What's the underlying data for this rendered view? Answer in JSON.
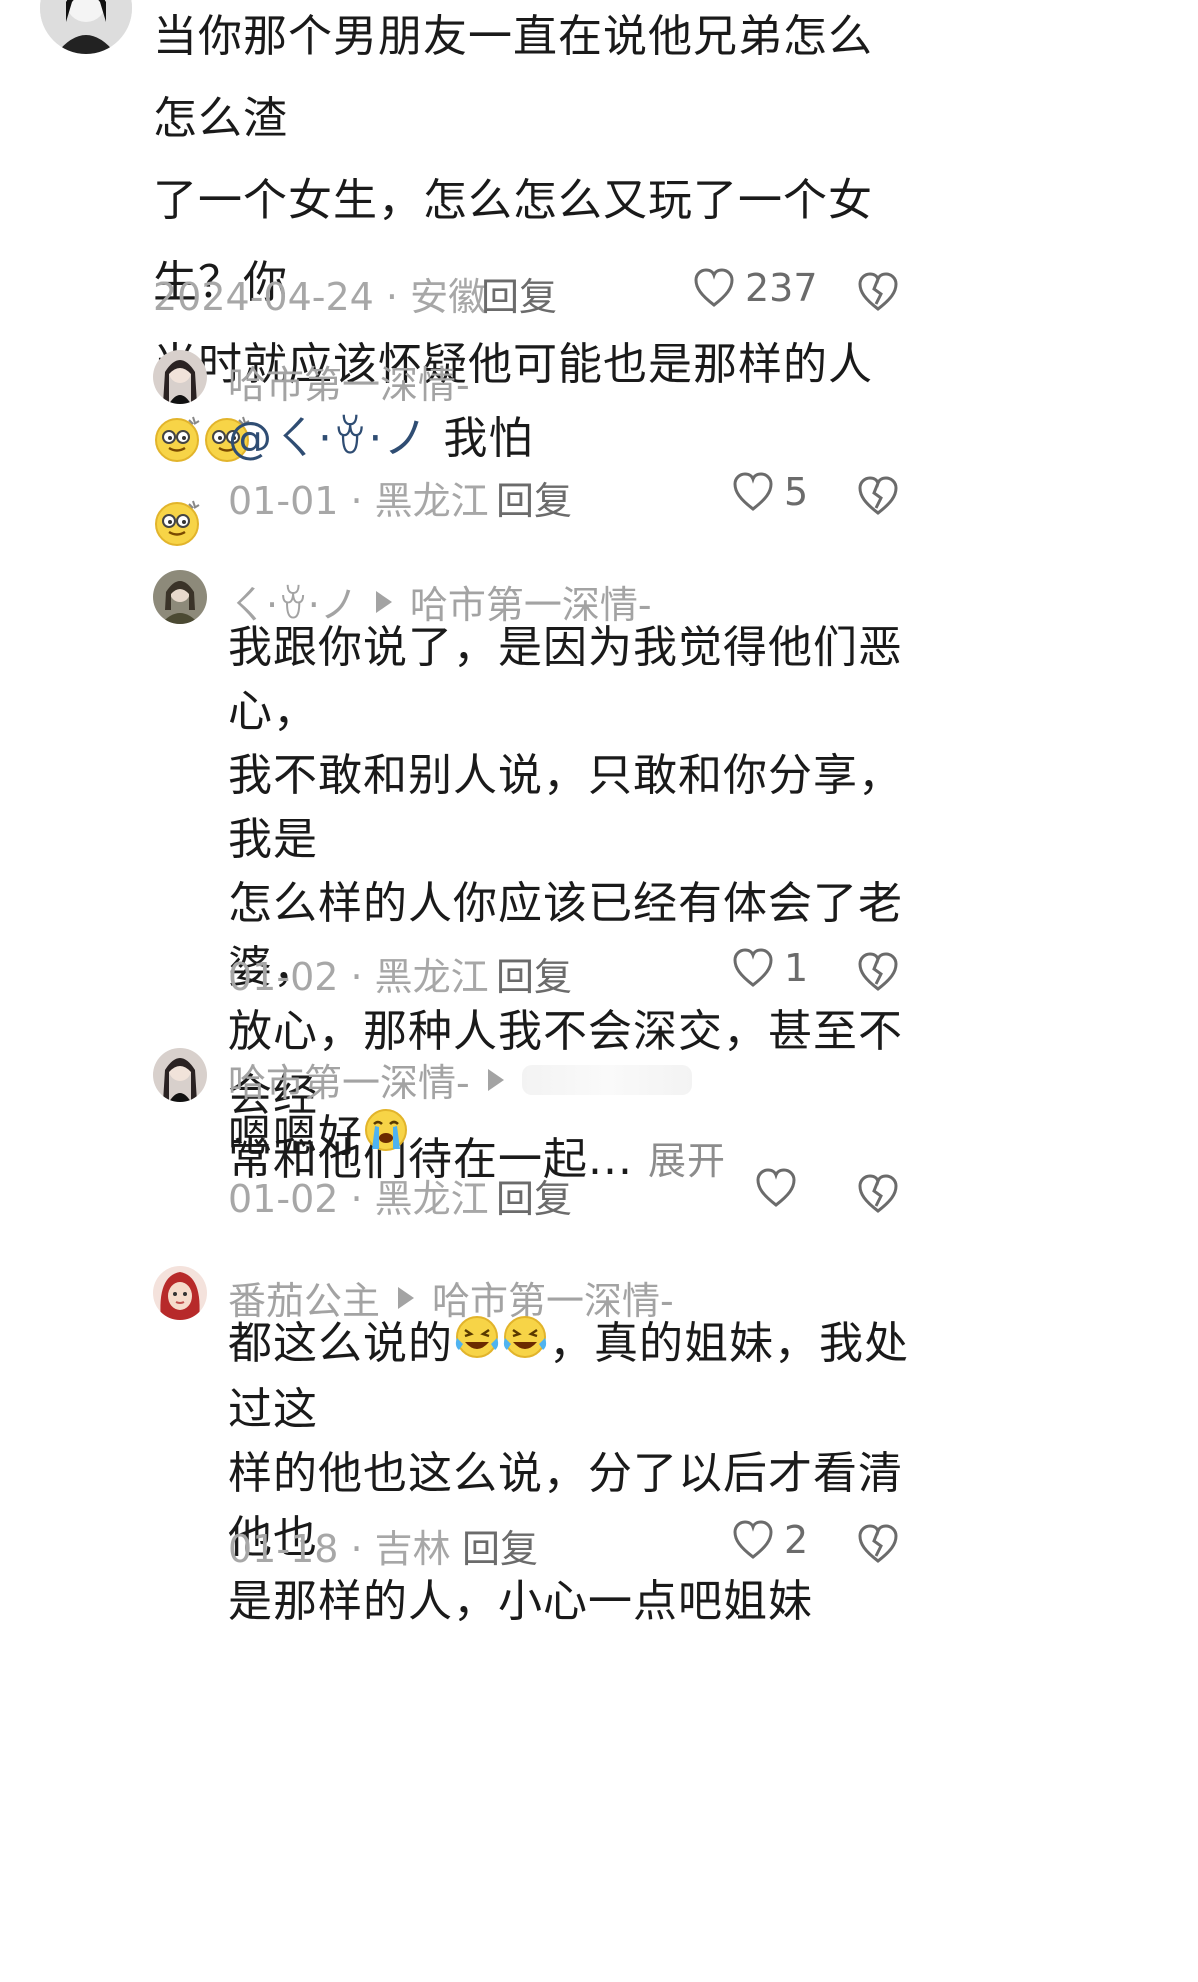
{
  "comments": [
    {
      "text": "当你那个男朋友一直在说他兄弟怎么怎么渣了一个女生，怎么怎么又玩了一个女生？你当时就应该怀疑他可能也是那样的人",
      "date": "2024-04-24 · 安徽",
      "reply": "回复",
      "likes": "237"
    },
    {
      "name": "哈市第一深情-",
      "mention": "@ㄑ·ꈊ·ノ",
      "text": "我怕",
      "date": "01-01 · 黑龙江",
      "reply": "回复",
      "likes": "5"
    },
    {
      "name": "ㄑ·ꈊ·ノ",
      "target": "哈市第一深情-",
      "text": "我跟你说了，是因为我觉得他们恶心，我不敢和别人说，只敢和你分享，我是怎么样的人你应该已经有体会了老婆，放心，那种人我不会深交，甚至不会经常和他们待在一起...",
      "expand": "展开",
      "date": "01-02 · 黑龙江",
      "reply": "回复",
      "likes": "1"
    },
    {
      "name": "哈市第一深情-",
      "text": "嗯嗯好",
      "date": "01-02 · 黑龙江",
      "reply": "回复",
      "likes": ""
    },
    {
      "name": "番茄公主",
      "target": "哈市第一深情-",
      "text_a": "都这么说的",
      "text_b": "，真的姐妹，我处过这样的他也这么说，分了以后才看清他也是那样的人，小心一点吧姐妹",
      "date": "01-18 · 吉林",
      "reply": "回复",
      "likes": "2"
    }
  ],
  "lines": {
    "c0": [
      "当你那个男朋友一直在说他兄弟怎么怎么渣",
      "了一个女生，怎么怎么又玩了一个女生？你",
      "当时就应该怀疑他可能也是那样的人"
    ],
    "c2": [
      "我跟你说了，是因为我觉得他们恶心，",
      "我不敢和别人说，只敢和你分享，我是",
      "怎么样的人你应该已经有体会了老婆，",
      "放心，那种人我不会深交，甚至不会经",
      "常和他们待在一起..."
    ],
    "c4": [
      "，真的姐妹，我处过这",
      "样的他也这么说，分了以后才看清他也",
      "是那样的人，小心一点吧姐妹"
    ]
  },
  "colors": {
    "text": "#1a1a1a",
    "meta": "#a7a7a7",
    "mention": "#2f4d73",
    "icon": "#6b6b6b"
  },
  "icons": {
    "like": "heart-outline-icon",
    "dislike": "broken-heart-icon",
    "reply_arrow": "triangle-right-icon"
  }
}
